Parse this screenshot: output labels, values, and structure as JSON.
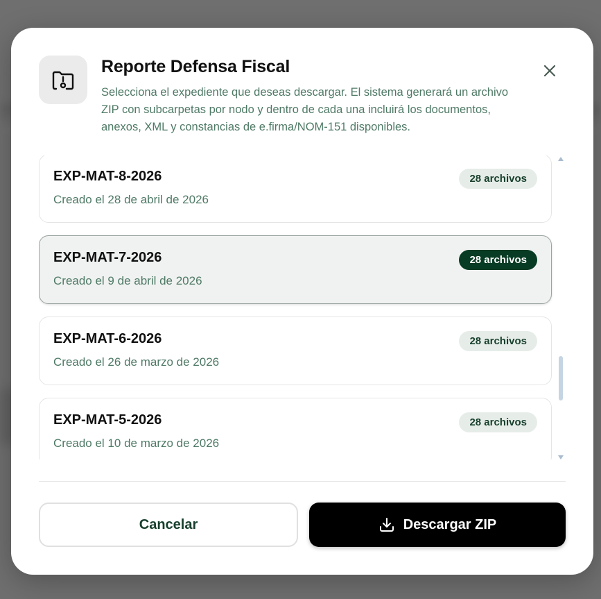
{
  "dialog": {
    "title": "Reporte Defensa Fiscal",
    "description": "Selecciona el expediente que deseas descargar. El sistema generará un archivo ZIP con subcarpetas por nodo y dentro de cada una incluirá los documentos, anexos, XML y constancias de e.firma/NOM-151 disponibles.",
    "header_icon": "folder-lock-icon",
    "close_icon": "close-icon"
  },
  "expedientes": [
    {
      "name": "EXP-MAT-8-2026",
      "created": "Creado el 28 de abril de 2026",
      "files": "28 archivos",
      "selected": false
    },
    {
      "name": "EXP-MAT-7-2026",
      "created": "Creado el 9 de abril de 2026",
      "files": "28 archivos",
      "selected": true
    },
    {
      "name": "EXP-MAT-6-2026",
      "created": "Creado el 26 de marzo de 2026",
      "files": "28 archivos",
      "selected": false
    },
    {
      "name": "EXP-MAT-5-2026",
      "created": "Creado el 10 de marzo de 2026",
      "files": "28 archivos",
      "selected": false
    }
  ],
  "actions": {
    "cancel_label": "Cancelar",
    "download_label": "Descargar ZIP",
    "download_icon": "download-icon"
  },
  "colors": {
    "accent_dark_green": "#073b23",
    "muted_green_text": "#4f7a66",
    "badge_bg": "#e6ede9"
  }
}
